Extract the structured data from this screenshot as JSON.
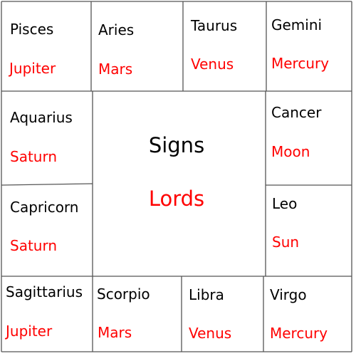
{
  "colors": {
    "sign_text": "#000000",
    "lord_text": "#ff0000",
    "grid_line": "#555555",
    "background": "#ffffff"
  },
  "center": {
    "sign_label": "Signs",
    "lord_label": "Lords"
  },
  "houses": {
    "pisces": {
      "sign": "Pisces",
      "lord": "Jupiter"
    },
    "aries": {
      "sign": "Aries",
      "lord": "Mars"
    },
    "taurus": {
      "sign": "Taurus",
      "lord": "Venus"
    },
    "gemini": {
      "sign": "Gemini",
      "lord": "Mercury"
    },
    "aquarius": {
      "sign": "Aquarius",
      "lord": "Saturn"
    },
    "cancer": {
      "sign": "Cancer",
      "lord": "Moon"
    },
    "capricorn": {
      "sign": "Capricorn",
      "lord": "Saturn"
    },
    "leo": {
      "sign": "Leo",
      "lord": "Sun"
    },
    "sagittarius": {
      "sign": "Sagittarius",
      "lord": "Jupiter"
    },
    "scorpio": {
      "sign": "Scorpio",
      "lord": "Mars"
    },
    "libra": {
      "sign": "Libra",
      "lord": "Venus"
    },
    "virgo": {
      "sign": "Virgo",
      "lord": "Mercury"
    }
  }
}
